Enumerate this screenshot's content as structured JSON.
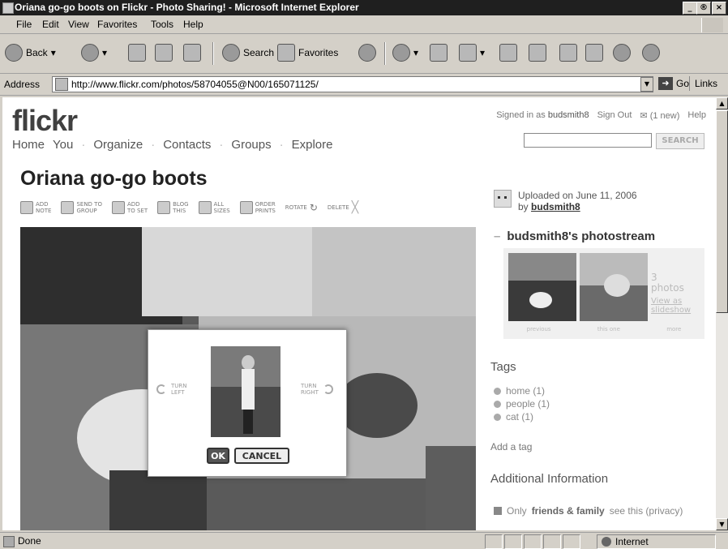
{
  "window": {
    "title": "Oriana go-go boots on Flickr - Photo Sharing! - Microsoft Internet Explorer",
    "minimize": "_",
    "maximize": "®",
    "close": "×"
  },
  "menu": [
    "File",
    "Edit",
    "View",
    "Favorites",
    "Tools",
    "Help"
  ],
  "toolbar": {
    "back": "Back",
    "search": "Search",
    "favorites": "Favorites"
  },
  "address": {
    "label": "Address",
    "url": "http://www.flickr.com/photos/58704055@N00/165071125/",
    "go": "Go",
    "links": "Links"
  },
  "flickr": {
    "logo": "flickr",
    "nav": [
      "Home",
      "You",
      "Organize",
      "Contacts",
      "Groups",
      "Explore"
    ],
    "signed_in_prefix": "Signed in as",
    "username": "budsmith8",
    "sign_out": "Sign Out",
    "new_messages": "(1 new)",
    "help": "Help",
    "search_button": "SEARCH"
  },
  "photo": {
    "title": "Oriana go-go boots",
    "actions": [
      {
        "l1": "ADD",
        "l2": "NOTE"
      },
      {
        "l1": "SEND TO",
        "l2": "GROUP"
      },
      {
        "l1": "ADD",
        "l2": "TO SET"
      },
      {
        "l1": "BLOG",
        "l2": "THIS"
      },
      {
        "l1": "ALL",
        "l2": "SIZES"
      },
      {
        "l1": "ORDER",
        "l2": "PRINTS"
      }
    ],
    "rotate": "ROTATE",
    "delete": "DELETE"
  },
  "rotate_dialog": {
    "turn_left_1": "TURN",
    "turn_left_2": "LEFT",
    "turn_right_1": "TURN",
    "turn_right_2": "RIGHT",
    "ok": "OK",
    "cancel": "CANCEL"
  },
  "sidebar": {
    "uploaded": "Uploaded on June 11, 2006",
    "by": "by",
    "author": "budsmith8",
    "photostream_title": "budsmith8's photostream",
    "photo_count": "3",
    "photos_label": "photos",
    "view_as": "View as",
    "slideshow": "slideshow",
    "nav": [
      "previous",
      "this one",
      "more"
    ],
    "tags_heading": "Tags",
    "tags": [
      "home (1)",
      "people (1)",
      "cat (1)"
    ],
    "add_tag": "Add a tag",
    "additional_info": "Additional Information",
    "privacy_prefix": "Only",
    "privacy_group": "friends & family",
    "privacy_suffix": "see this (privacy)"
  },
  "status": {
    "text": "Done",
    "zone": "Internet"
  },
  "colors": {
    "ie_chrome": "#d4d0c8",
    "titlebar": "#1f1f1f",
    "page_bg": "#ffffff"
  }
}
